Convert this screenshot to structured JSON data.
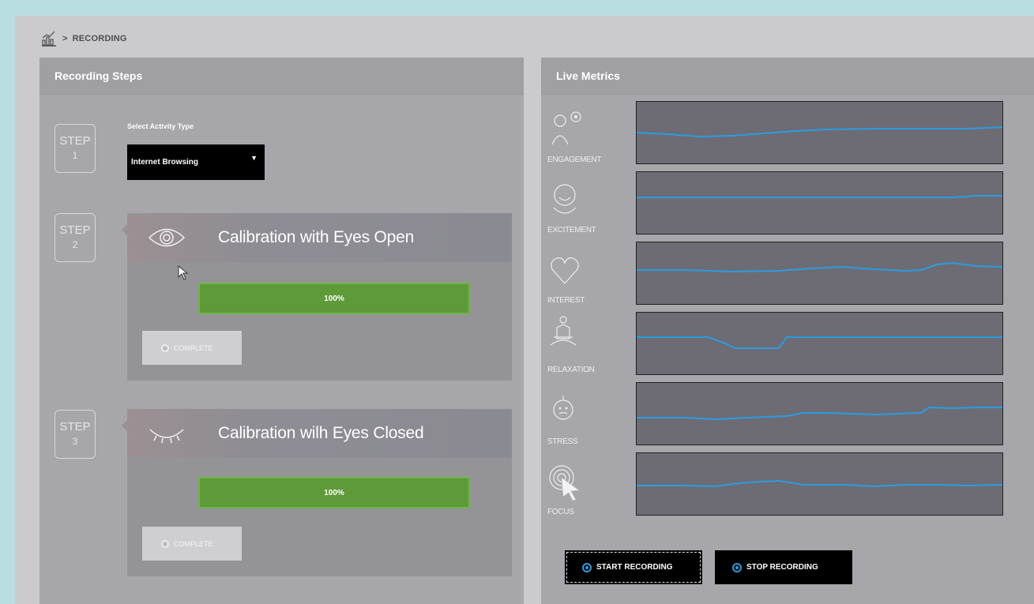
{
  "breadcrumb": {
    "separator": ">",
    "current": "RECORDING"
  },
  "left_panel": {
    "title": "Recording Steps",
    "steps": [
      {
        "badge": "STEP",
        "num": "1"
      },
      {
        "badge": "STEP",
        "num": "2"
      },
      {
        "badge": "STEP",
        "num": "3"
      }
    ],
    "activity": {
      "label": "Select Activity Type",
      "value": "Internet Browsing"
    },
    "calibrations": [
      {
        "title": "Calibration with Eyes Open",
        "progress": 1.0,
        "progress_label": "100%",
        "button": "COMPLETE",
        "icon": "eye-open-icon"
      },
      {
        "title": "Calibration wilh Eyes Closed",
        "progress": 1.0,
        "progress_label": "100%",
        "button": "COMPLETE",
        "icon": "eye-closed-icon"
      }
    ]
  },
  "right_panel": {
    "title": "Live Metrics",
    "metrics": [
      {
        "label": "ENGAGEMENT",
        "icon": "engagement-icon"
      },
      {
        "label": "EXCITEMENT",
        "icon": "excitement-icon"
      },
      {
        "label": "INTEREST",
        "icon": "heart-icon"
      },
      {
        "label": "RELAXATION",
        "icon": "meditation-icon"
      },
      {
        "label": "STRESS",
        "icon": "stress-icon"
      },
      {
        "label": "FOCUS",
        "icon": "focus-icon"
      }
    ],
    "buttons": {
      "start": "START RECORDING",
      "stop": "STOP RECORDING"
    }
  },
  "colors": {
    "background": "#b9dee2",
    "panel": "#a6a6ab",
    "progress": "#5f9a38",
    "graph_line": "#2a9de0",
    "graph_bg": "#6d6c75"
  }
}
